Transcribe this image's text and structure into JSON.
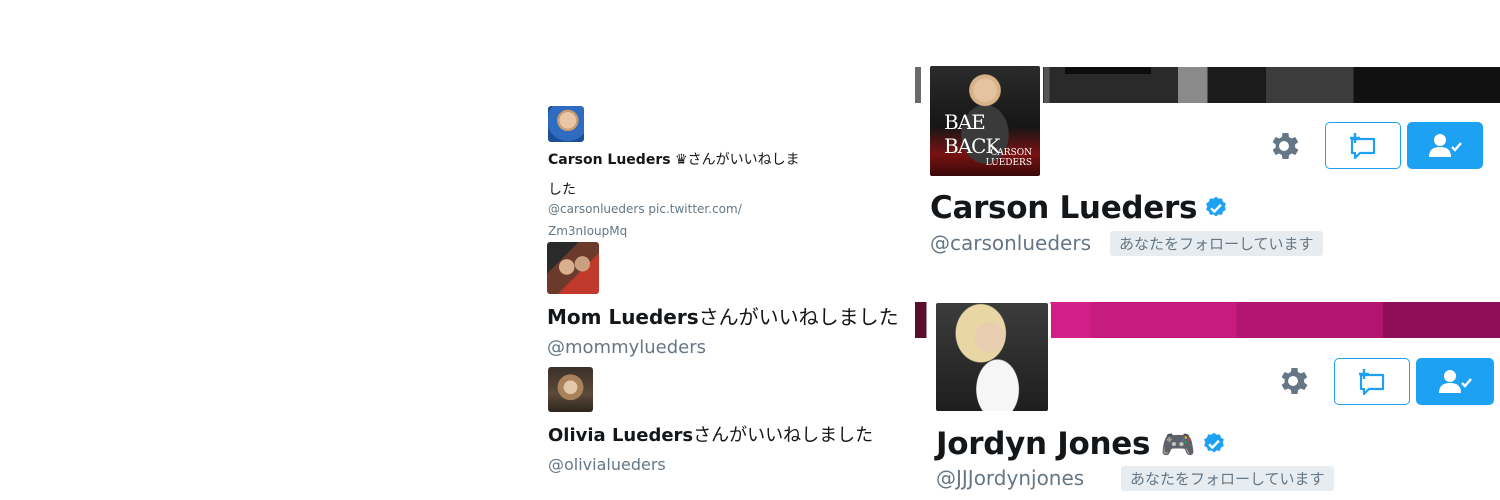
{
  "likes": [
    {
      "name": "Carson Lueders",
      "crown": "♛",
      "action_line1": "さんがいいねしま",
      "action_line2": "した",
      "tweet_line1": "@carsonlueders pic.twitter.com/",
      "tweet_line2": "Zm3nIoupMq"
    },
    {
      "name": "Mom Lueders",
      "action": "さんがいいねしました",
      "handle": "@mommylueders"
    },
    {
      "name": "Olivia Lueders",
      "action": "さんがいいねしました",
      "handle": "@olivialueders"
    }
  ],
  "profiles": [
    {
      "avatar_text_1": "BAE BACK",
      "avatar_text_2": "CARSON\nLUEDERS",
      "name": "Carson Lueders",
      "handle": "@carsonlueders",
      "follows_you": "あなたをフォローしています",
      "verified": true
    },
    {
      "name": "Jordyn Jones",
      "emoji": "🎮",
      "handle": "@JJJordynjones",
      "follows_you": "あなたをフォローしています",
      "verified": true
    }
  ],
  "icons": {
    "settings": "gear-icon",
    "list": "add-to-list-icon",
    "following": "following-user-check-icon",
    "verified": "verified-badge-icon"
  },
  "colors": {
    "accent": "#1da1f2",
    "muted_text": "#657786",
    "follows_bg": "#e6ecf0",
    "primary_text": "#14171a"
  }
}
